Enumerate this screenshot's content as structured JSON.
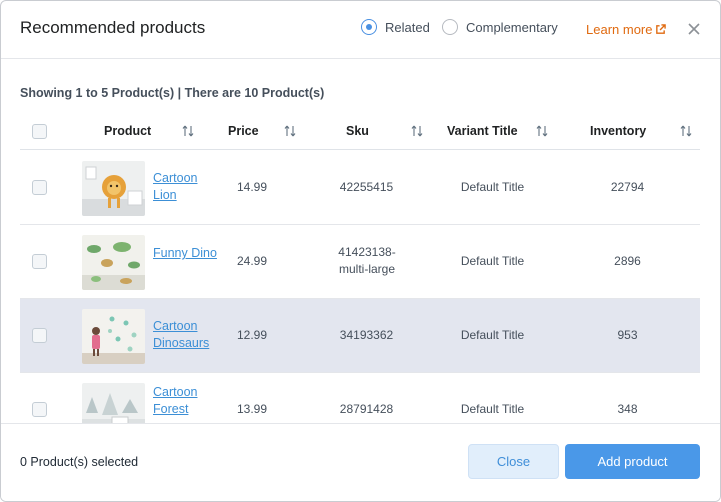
{
  "header": {
    "title": "Recommended products",
    "radio_related": "Related",
    "radio_complementary": "Complementary",
    "learn_more": "Learn more"
  },
  "summary": "Showing 1 to 5 Product(s) | There are 10 Product(s)",
  "columns": {
    "product": "Product",
    "price": "Price",
    "sku": "Sku",
    "variant": "Variant Title",
    "inventory": "Inventory"
  },
  "rows": [
    {
      "name": "Cartoon Lion",
      "price": "14.99",
      "sku": "42255415",
      "variant": "Default Title",
      "inventory": "22794"
    },
    {
      "name": "Funny Dino",
      "price": "24.99",
      "sku": "41423138-multi-large",
      "variant": "Default Title",
      "inventory": "2896"
    },
    {
      "name": "Cartoon Dinosaurs",
      "price": "12.99",
      "sku": "34193362",
      "variant": "Default Title",
      "inventory": "953"
    },
    {
      "name": "Cartoon Forest",
      "price": "13.99",
      "sku": "28791428",
      "variant": "Default Title",
      "inventory": "348"
    }
  ],
  "footer": {
    "selected_count": "0 Product(s) selected",
    "close": "Close",
    "add": "Add product"
  },
  "colors": {
    "accent": "#4a98e8",
    "link": "#3c8fd6",
    "learn_more": "#e06a10",
    "row_highlight": "#e3e6ef"
  }
}
